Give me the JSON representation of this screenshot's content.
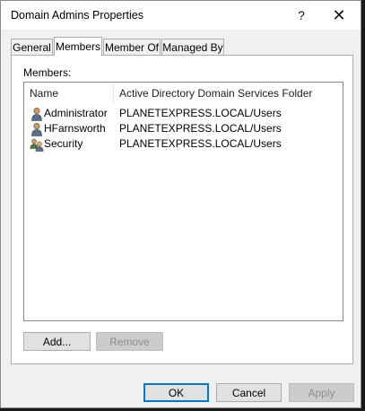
{
  "window": {
    "title": "Domain Admins Properties",
    "help_glyph": "?",
    "close_glyph": "✕"
  },
  "tabs": [
    {
      "label": "General",
      "active": false
    },
    {
      "label": "Members",
      "active": true
    },
    {
      "label": "Member Of",
      "active": false
    },
    {
      "label": "Managed By",
      "active": false
    }
  ],
  "members": {
    "label": "Members:",
    "columns": [
      "Name",
      "Active Directory Domain Services Folder"
    ],
    "rows": [
      {
        "name": "Administrator",
        "folder": "PLANETEXPRESS.LOCAL/Users",
        "icon": "user-icon"
      },
      {
        "name": "HFarnsworth",
        "folder": "PLANETEXPRESS.LOCAL/Users",
        "icon": "user-icon"
      },
      {
        "name": "Security",
        "folder": "PLANETEXPRESS.LOCAL/Users",
        "icon": "group-icon"
      }
    ]
  },
  "actions": {
    "add": "Add...",
    "remove": "Remove"
  },
  "footer": {
    "ok": "OK",
    "cancel": "Cancel",
    "apply": "Apply"
  },
  "colors": {
    "accent": "#0078d7",
    "window_bg": "#f0f0f0",
    "panel_bg": "#ffffff"
  }
}
